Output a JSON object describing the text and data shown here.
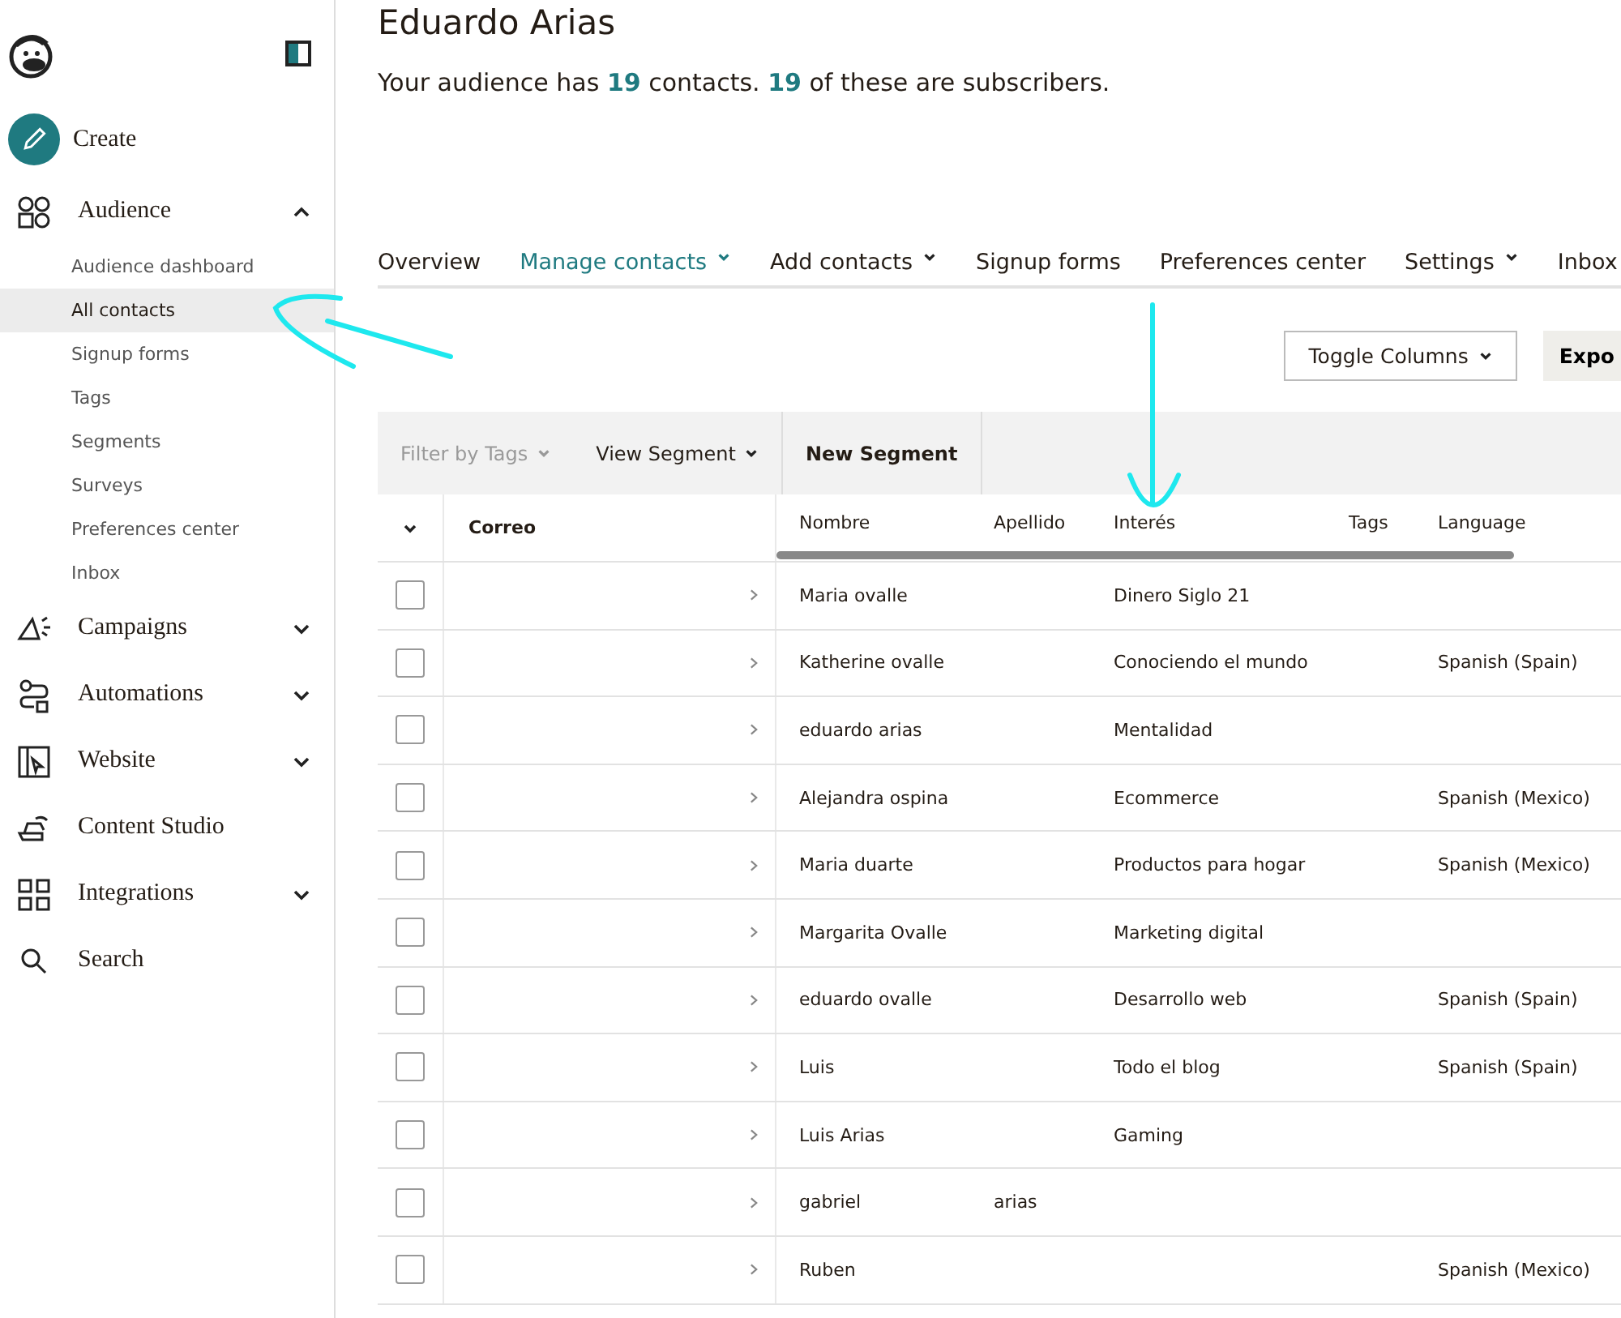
{
  "sidebar": {
    "items": [
      {
        "kind": "create",
        "label": "Create"
      },
      {
        "kind": "group",
        "label": "Audience",
        "expanded": true,
        "children": [
          {
            "label": "Audience dashboard",
            "selected": false
          },
          {
            "label": "All contacts",
            "selected": true
          },
          {
            "label": "Signup forms",
            "selected": false
          },
          {
            "label": "Tags",
            "selected": false
          },
          {
            "label": "Segments",
            "selected": false
          },
          {
            "label": "Surveys",
            "selected": false
          },
          {
            "label": "Preferences center",
            "selected": false
          },
          {
            "label": "Inbox",
            "selected": false
          }
        ]
      },
      {
        "kind": "group",
        "label": "Campaigns",
        "expanded": false
      },
      {
        "kind": "group",
        "label": "Automations",
        "expanded": false
      },
      {
        "kind": "group",
        "label": "Website",
        "expanded": false
      },
      {
        "kind": "link",
        "label": "Content Studio"
      },
      {
        "kind": "group",
        "label": "Integrations",
        "expanded": false
      },
      {
        "kind": "link",
        "label": "Search"
      }
    ]
  },
  "page": {
    "title": "Eduardo Arias",
    "summary": "Your audience has **19** contacts. **19** of these are subscribers."
  },
  "tabs": [
    {
      "label": "Overview",
      "selected": false,
      "dropdown": false
    },
    {
      "label": "Manage contacts",
      "selected": true,
      "dropdown": true
    },
    {
      "label": "Add contacts",
      "selected": false,
      "dropdown": true
    },
    {
      "label": "Signup forms",
      "selected": false,
      "dropdown": false
    },
    {
      "label": "Preferences center",
      "selected": false,
      "dropdown": false
    },
    {
      "label": "Settings",
      "selected": false,
      "dropdown": true
    },
    {
      "label": "Inbox",
      "selected": false,
      "dropdown": false
    }
  ],
  "actions": {
    "toggle_columns": "Toggle Columns",
    "export": "Expo"
  },
  "toolbar": {
    "filter": "Filter by Tags",
    "view_segment": "View Segment",
    "new_segment": "New Segment"
  },
  "table": {
    "columns": [
      "Correo",
      "Nombre",
      "Apellido",
      "Interés",
      "Tags",
      "Language"
    ],
    "rows": [
      {
        "checked": false,
        "nombre": "Maria ovalle",
        "apellido": "",
        "interes": "Dinero Siglo 21",
        "language": ""
      },
      {
        "checked": false,
        "nombre": "Katherine ovalle",
        "apellido": "",
        "interes": "Conociendo el mundo",
        "language": "Spanish (Spain)"
      },
      {
        "checked": false,
        "nombre": "eduardo arias",
        "apellido": "",
        "interes": "Mentalidad",
        "language": ""
      },
      {
        "checked": false,
        "nombre": "Alejandra ospina",
        "apellido": "",
        "interes": "Ecommerce",
        "language": "Spanish (Mexico)"
      },
      {
        "checked": false,
        "nombre": "Maria duarte",
        "apellido": "",
        "interes": "Productos para hogar",
        "language": "Spanish (Mexico)"
      },
      {
        "checked": false,
        "nombre": "Margarita Ovalle",
        "apellido": "",
        "interes": "Marketing digital",
        "language": ""
      },
      {
        "checked": false,
        "nombre": "eduardo ovalle",
        "apellido": "",
        "interes": "Desarrollo web",
        "language": "Spanish (Spain)"
      },
      {
        "checked": false,
        "nombre": "Luis",
        "apellido": "",
        "interes": "Todo el blog",
        "language": "Spanish (Spain)"
      },
      {
        "checked": false,
        "nombre": "Luis Arias",
        "apellido": "",
        "interes": "Gaming",
        "language": ""
      },
      {
        "checked": false,
        "nombre": "gabriel",
        "apellido": "arias",
        "interes": "",
        "language": ""
      },
      {
        "checked": false,
        "nombre": "Ruben",
        "apellido": "",
        "interes": "",
        "language": "Spanish (Mexico)"
      }
    ]
  }
}
